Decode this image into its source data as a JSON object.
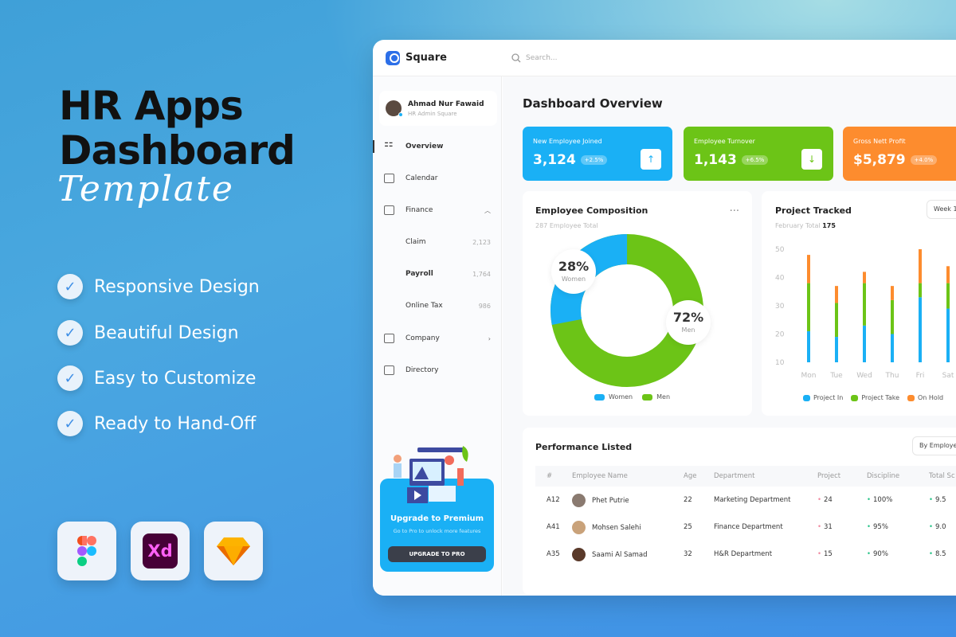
{
  "hero": {
    "title_line1": "HR Apps",
    "title_line2": "Dashboard",
    "script": "Template",
    "features": [
      "Responsive Design",
      "Beautiful Design",
      "Easy to Customize",
      "Ready to Hand-Off"
    ],
    "tools": [
      "figma-icon",
      "xd-icon",
      "sketch-icon"
    ],
    "xd_label": "Xd"
  },
  "app": {
    "name": "Square",
    "search_placeholder": "Search..."
  },
  "user": {
    "name": "Ahmad Nur Fawaid",
    "role": "HR Admin Square"
  },
  "sidebar": {
    "items": [
      {
        "label": "Overview",
        "icon": "grid-icon",
        "active": true
      },
      {
        "label": "Calendar",
        "icon": "calendar-icon"
      },
      {
        "label": "Finance",
        "icon": "finance-icon",
        "expanded": true
      },
      {
        "label": "Claim",
        "count": "2,123"
      },
      {
        "label": "Payroll",
        "count": "1,764"
      },
      {
        "label": "Online Tax",
        "count": "986"
      },
      {
        "label": "Company",
        "icon": "briefcase-icon"
      },
      {
        "label": "Directory",
        "icon": "directory-icon"
      }
    ]
  },
  "promo": {
    "title": "Upgrade to Premium",
    "subtitle": "Go to Pro to unlock more features",
    "button": "UPGRADE TO PRO"
  },
  "page_title": "Dashboard Overview",
  "stats": [
    {
      "label": "New Employee Joined",
      "value": "3,124",
      "change": "+2.5%",
      "color": "#1ab0f5",
      "icon": "arrow-up-icon"
    },
    {
      "label": "Employee Turnover",
      "value": "1,143",
      "change": "+6.5%",
      "color": "#6cc417",
      "icon": "arrow-down-icon"
    },
    {
      "label": "Gross Nett Profit",
      "value": "$5,879",
      "change": "+4.0%",
      "color": "#fd8c2e"
    }
  ],
  "composition": {
    "title": "Employee Composition",
    "subtitle": "287 Employee Total",
    "menu": "...",
    "women_pct": "28%",
    "women_label": "Women",
    "men_pct": "72%",
    "men_label": "Men",
    "legend": [
      "Women",
      "Men"
    ],
    "colors": {
      "women": "#1ab0f5",
      "men": "#6cc417"
    }
  },
  "chart_data": {
    "type": "bar",
    "stacked": true,
    "title": "Project Tracked",
    "subtitle_label": "February Total",
    "subtitle_value": "175",
    "filter": "Week 1",
    "categories": [
      "Mon",
      "Tue",
      "Wed",
      "Thu",
      "Fri",
      "Sat"
    ],
    "yticks": [
      "50",
      "40",
      "30",
      "20",
      "10"
    ],
    "ylim": [
      10,
      50
    ],
    "series": [
      {
        "name": "Project In",
        "color": "#1ab0f5",
        "top": [
          21,
          19,
          23,
          20,
          33,
          29
        ]
      },
      {
        "name": "Project Take",
        "color": "#6cc417",
        "top": [
          38,
          31,
          38,
          32,
          38,
          38
        ]
      },
      {
        "name": "On Hold",
        "color": "#fd8c2e",
        "top": [
          48,
          37,
          42,
          37,
          50,
          44
        ]
      }
    ],
    "legend": "bottom"
  },
  "performance": {
    "title": "Performance Listed",
    "filter": "By Employe",
    "columns": [
      "#",
      "Employee Name",
      "Age",
      "Department",
      "Project",
      "Discipline",
      "Total Sc"
    ],
    "rows": [
      {
        "id": "A12",
        "name": "Phet Putrie",
        "age": "22",
        "dept": "Marketing Department",
        "project": "24",
        "discipline": "100%",
        "score": "9.5"
      },
      {
        "id": "A41",
        "name": "Mohsen Salehi",
        "age": "25",
        "dept": "Finance Department",
        "project": "31",
        "discipline": "95%",
        "score": "9.0"
      },
      {
        "id": "A35",
        "name": "Saami Al Samad",
        "age": "32",
        "dept": "H&R Department",
        "project": "15",
        "discipline": "90%",
        "score": "8.5"
      }
    ]
  }
}
